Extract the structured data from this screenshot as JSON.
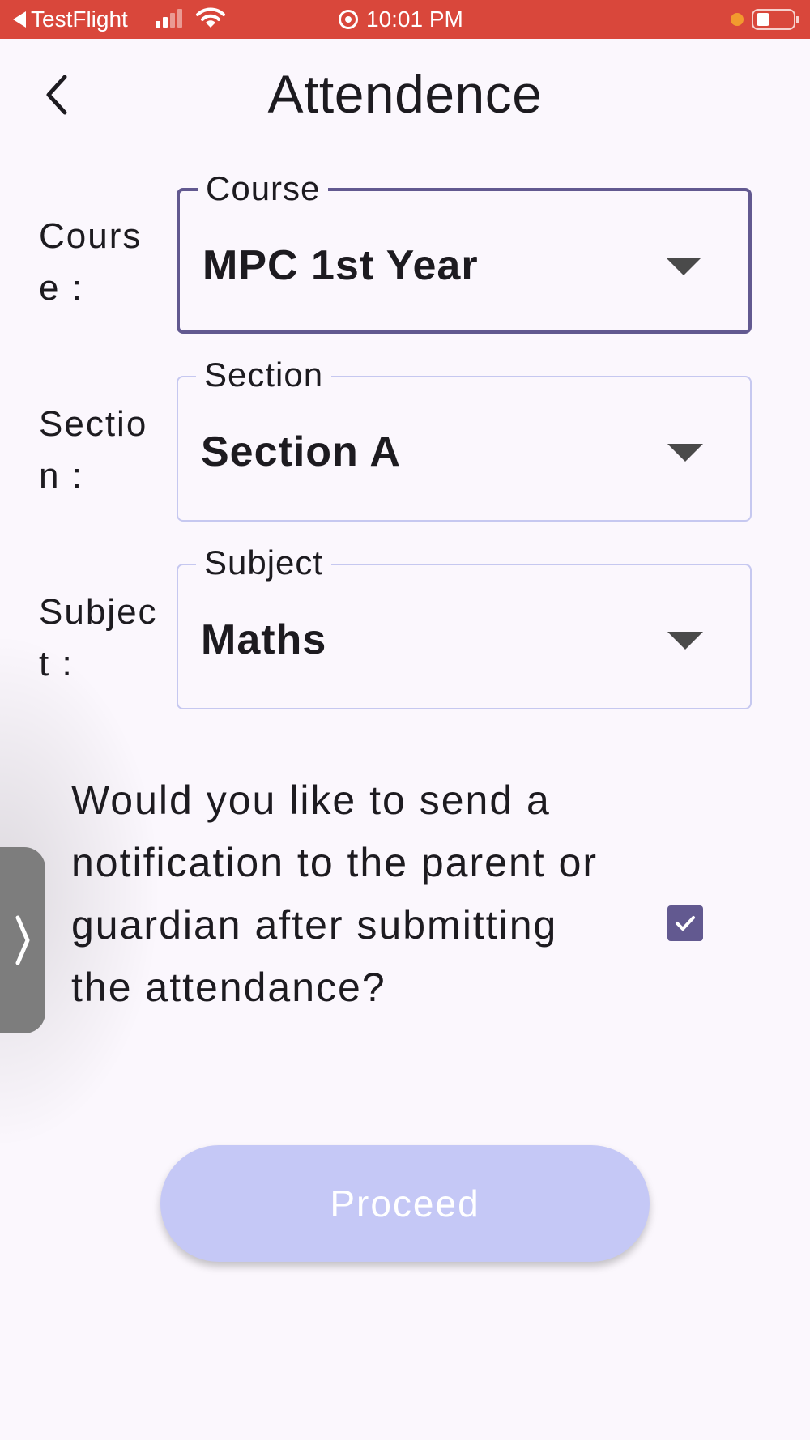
{
  "status_bar": {
    "back_app_label": "TestFlight",
    "time": "10:01 PM"
  },
  "header": {
    "title": "Attendence",
    "back_icon": "chevron-left-icon"
  },
  "form": {
    "course": {
      "row_label": "Course :",
      "field_label": "Course",
      "selected_value": "MPC 1st Year"
    },
    "section": {
      "row_label": "Section :",
      "field_label": "Section",
      "selected_value": "Section A"
    },
    "subject": {
      "row_label": "Subject :",
      "field_label": "Subject",
      "selected_value": "Maths"
    }
  },
  "notification": {
    "question": "Would you like to send a notification to the parent or guardian after submitting the attendance?",
    "checked": true
  },
  "proceed_label": "Proceed",
  "colors": {
    "status_bar": "#d9473b",
    "accent": "#625990",
    "button_fill": "#c5c8f6",
    "outline": "#c6c8f0",
    "background": "#fbf7fd"
  }
}
